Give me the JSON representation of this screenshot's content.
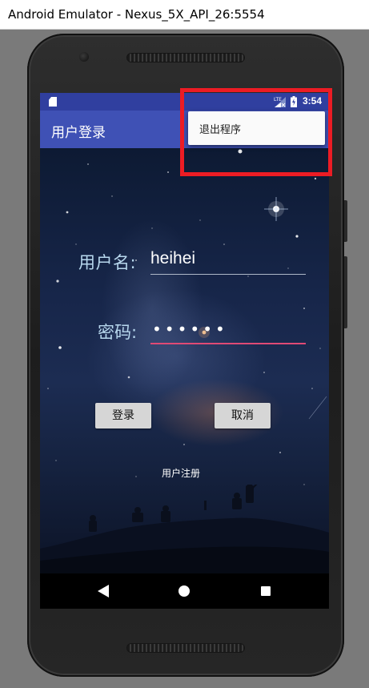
{
  "window": {
    "title": "Android Emulator - Nexus_5X_API_26:5554"
  },
  "status_bar": {
    "time": "3:54",
    "network_label": "LTE"
  },
  "app_bar": {
    "title": "用户登录"
  },
  "overflow_menu": {
    "items": [
      {
        "label": "退出程序"
      }
    ]
  },
  "form": {
    "username_label": "用户名:",
    "username_value": "heihei",
    "password_label": "密码:",
    "password_masked": "••••••",
    "login_button": "登录",
    "cancel_button": "取消",
    "register_link": "用户注册"
  },
  "navigation": {
    "icons": [
      "back-icon",
      "home-icon",
      "recent-apps-icon"
    ]
  },
  "colors": {
    "status_bar": "#303f9f",
    "app_bar": "#3f51b5",
    "password_underline": "#e04a75",
    "highlight": "#ec1c24",
    "label_text": "#b8d8ee"
  }
}
